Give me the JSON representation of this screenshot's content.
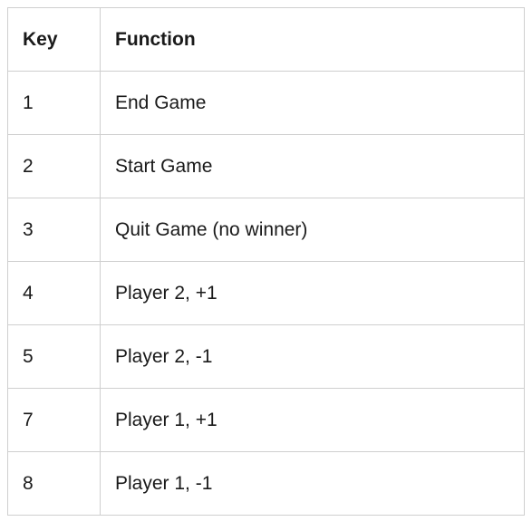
{
  "table": {
    "headers": {
      "key": "Key",
      "function": "Function"
    },
    "rows": [
      {
        "key": "1",
        "function": "End Game"
      },
      {
        "key": "2",
        "function": "Start Game"
      },
      {
        "key": "3",
        "function": "Quit Game (no winner)"
      },
      {
        "key": "4",
        "function": "Player 2, +1"
      },
      {
        "key": "5",
        "function": "Player 2, -1"
      },
      {
        "key": "7",
        "function": "Player 1, +1"
      },
      {
        "key": "8",
        "function": "Player 1, -1"
      }
    ]
  }
}
